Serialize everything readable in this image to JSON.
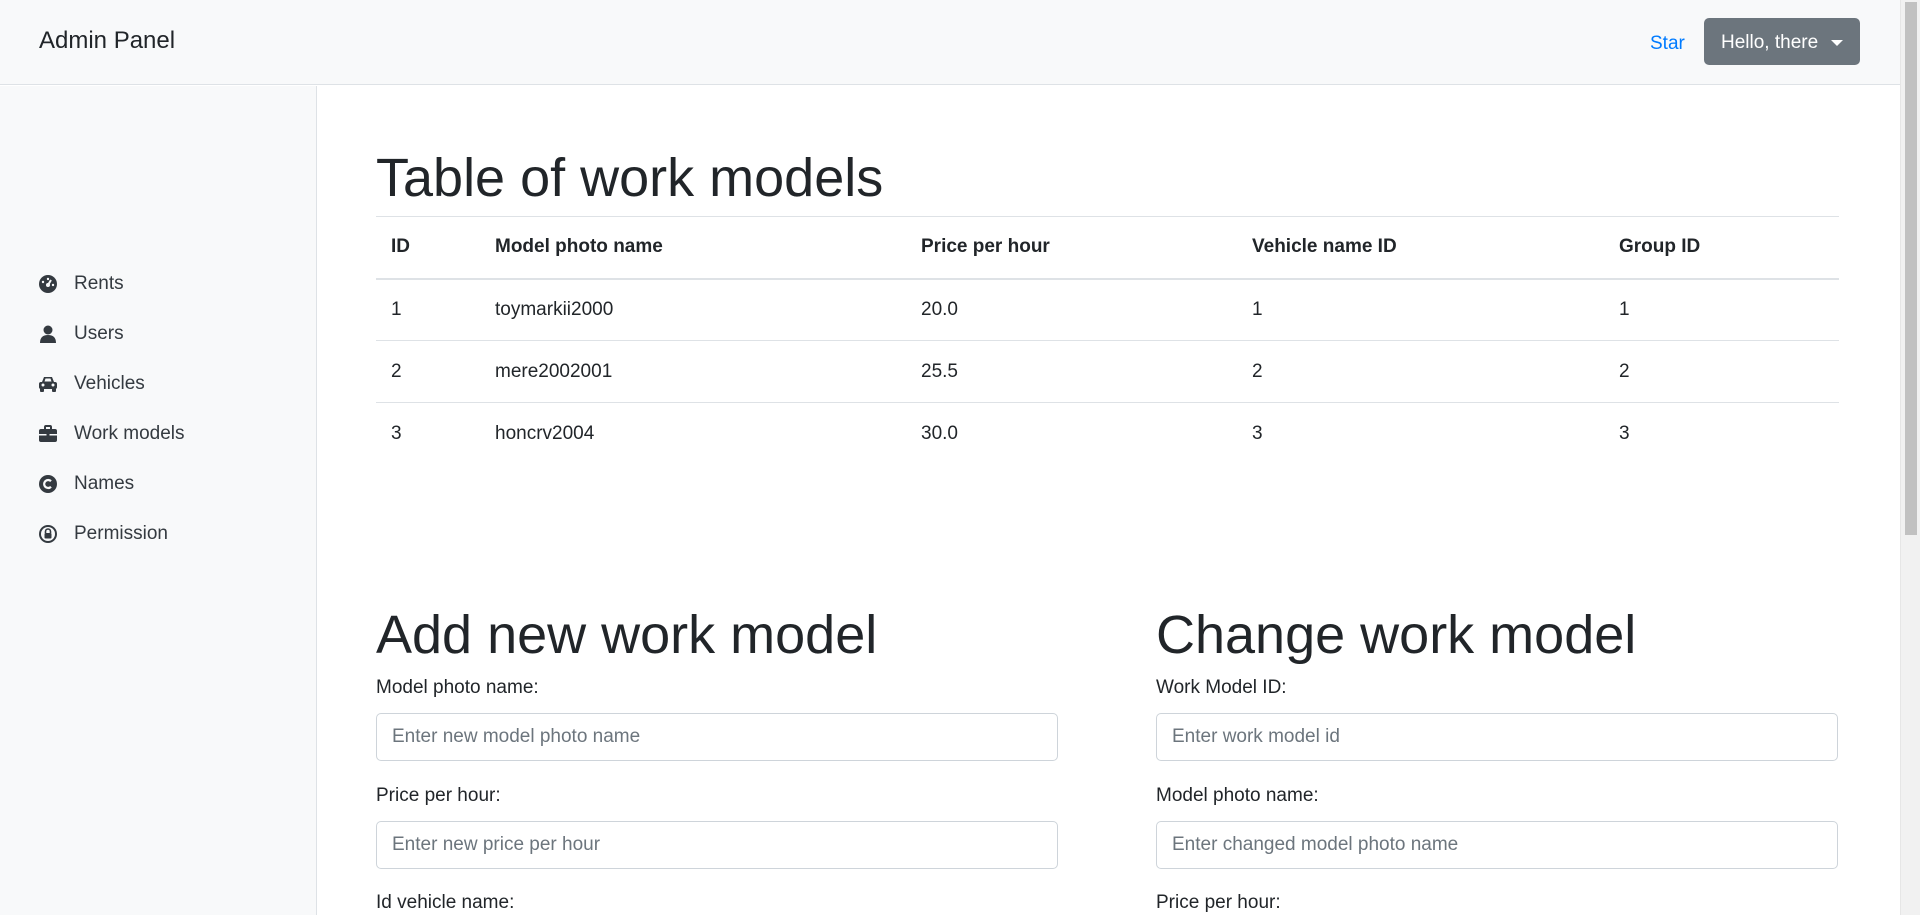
{
  "navbar": {
    "brand": "Admin Panel",
    "star_link": "Star",
    "user_menu": "Hello, there"
  },
  "sidebar": {
    "items": [
      {
        "label": "Rents",
        "icon": "tachometer-icon"
      },
      {
        "label": "Users",
        "icon": "user-icon"
      },
      {
        "label": "Vehicles",
        "icon": "car-icon"
      },
      {
        "label": "Work models",
        "icon": "briefcase-icon"
      },
      {
        "label": "Names",
        "icon": "copyright-icon"
      },
      {
        "label": "Permission",
        "icon": "lock-icon"
      }
    ]
  },
  "table_section": {
    "title": "Table of work models",
    "columns": [
      "ID",
      "Model photo name",
      "Price per hour",
      "Vehicle name ID",
      "Group ID"
    ],
    "rows": [
      [
        "1",
        "toymarkii2000",
        "20.0",
        "1",
        "1"
      ],
      [
        "2",
        "mere2002001",
        "25.5",
        "2",
        "2"
      ],
      [
        "3",
        "honcrv2004",
        "30.0",
        "3",
        "3"
      ]
    ]
  },
  "add_form": {
    "title": "Add new work model",
    "photo_label": "Model photo name:",
    "photo_placeholder": "Enter new model photo name",
    "price_label": "Price per hour:",
    "price_placeholder": "Enter new price per hour",
    "vehicle_label": "Id vehicle name:"
  },
  "change_form": {
    "title": "Change work model",
    "id_label": "Work Model ID:",
    "id_placeholder": "Enter work model id",
    "photo_label": "Model photo name:",
    "photo_placeholder": "Enter changed model photo name",
    "price_label": "Price per hour:"
  }
}
